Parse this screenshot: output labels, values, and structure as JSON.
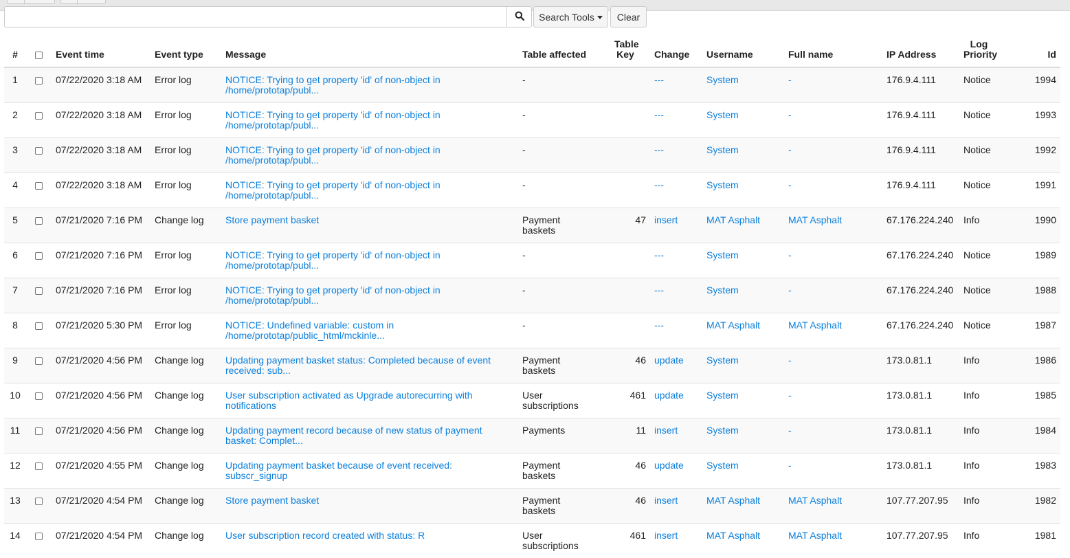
{
  "toolbar": {
    "search_value": "",
    "search_tools_label": "Search Tools",
    "clear_label": "Clear"
  },
  "columns": {
    "num": "#",
    "event_time": "Event time",
    "event_type": "Event type",
    "message": "Message",
    "table_affected": "Table affected",
    "table_key": "Table Key",
    "change": "Change",
    "username": "Username",
    "full_name": "Full name",
    "ip_address": "IP Address",
    "log_priority": "Log Priority",
    "id": "Id"
  },
  "rows": [
    {
      "num": "1",
      "time": "07/22/2020 3:18 AM",
      "type": "Error log",
      "message": "NOTICE: Trying to get property 'id' of non-object in /home/prototap/publ...",
      "table": "-",
      "key": "",
      "change": "---",
      "username": "System",
      "fullname": "-",
      "ip": "176.9.4.111",
      "priority": "Notice",
      "id": "1994"
    },
    {
      "num": "2",
      "time": "07/22/2020 3:18 AM",
      "type": "Error log",
      "message": "NOTICE: Trying to get property 'id' of non-object in /home/prototap/publ...",
      "table": "-",
      "key": "",
      "change": "---",
      "username": "System",
      "fullname": "-",
      "ip": "176.9.4.111",
      "priority": "Notice",
      "id": "1993"
    },
    {
      "num": "3",
      "time": "07/22/2020 3:18 AM",
      "type": "Error log",
      "message": "NOTICE: Trying to get property 'id' of non-object in /home/prototap/publ...",
      "table": "-",
      "key": "",
      "change": "---",
      "username": "System",
      "fullname": "-",
      "ip": "176.9.4.111",
      "priority": "Notice",
      "id": "1992"
    },
    {
      "num": "4",
      "time": "07/22/2020 3:18 AM",
      "type": "Error log",
      "message": "NOTICE: Trying to get property 'id' of non-object in /home/prototap/publ...",
      "table": "-",
      "key": "",
      "change": "---",
      "username": "System",
      "fullname": "-",
      "ip": "176.9.4.111",
      "priority": "Notice",
      "id": "1991"
    },
    {
      "num": "5",
      "time": "07/21/2020 7:16 PM",
      "type": "Change log",
      "message": "Store payment basket",
      "table": "Payment baskets",
      "key": "47",
      "change": "insert",
      "username": "MAT Asphalt",
      "fullname": "MAT Asphalt",
      "ip": "67.176.224.240",
      "priority": "Info",
      "id": "1990"
    },
    {
      "num": "6",
      "time": "07/21/2020 7:16 PM",
      "type": "Error log",
      "message": "NOTICE: Trying to get property 'id' of non-object in /home/prototap/publ...",
      "table": "-",
      "key": "",
      "change": "---",
      "username": "System",
      "fullname": "-",
      "ip": "67.176.224.240",
      "priority": "Notice",
      "id": "1989"
    },
    {
      "num": "7",
      "time": "07/21/2020 7:16 PM",
      "type": "Error log",
      "message": "NOTICE: Trying to get property 'id' of non-object in /home/prototap/publ...",
      "table": "-",
      "key": "",
      "change": "---",
      "username": "System",
      "fullname": "-",
      "ip": "67.176.224.240",
      "priority": "Notice",
      "id": "1988"
    },
    {
      "num": "8",
      "time": "07/21/2020 5:30 PM",
      "type": "Error log",
      "message": "NOTICE: Undefined variable: custom in /home/prototap/public_html/mckinle...",
      "table": "-",
      "key": "",
      "change": "---",
      "username": "MAT Asphalt",
      "fullname": "MAT Asphalt",
      "ip": "67.176.224.240",
      "priority": "Notice",
      "id": "1987"
    },
    {
      "num": "9",
      "time": "07/21/2020 4:56 PM",
      "type": "Change log",
      "message": "Updating payment basket status: Completed because of event received: sub...",
      "table": "Payment baskets",
      "key": "46",
      "change": "update",
      "username": "System",
      "fullname": "-",
      "ip": "173.0.81.1",
      "priority": "Info",
      "id": "1986"
    },
    {
      "num": "10",
      "time": "07/21/2020 4:56 PM",
      "type": "Change log",
      "message": "User subscription activated as Upgrade autorecurring with notifications",
      "table": "User subscriptions",
      "key": "461",
      "change": "update",
      "username": "System",
      "fullname": "-",
      "ip": "173.0.81.1",
      "priority": "Info",
      "id": "1985"
    },
    {
      "num": "11",
      "time": "07/21/2020 4:56 PM",
      "type": "Change log",
      "message": "Updating payment record because of new status of payment basket: Complet...",
      "table": "Payments",
      "key": "11",
      "change": "insert",
      "username": "System",
      "fullname": "-",
      "ip": "173.0.81.1",
      "priority": "Info",
      "id": "1984"
    },
    {
      "num": "12",
      "time": "07/21/2020 4:55 PM",
      "type": "Change log",
      "message": "Updating payment basket because of event received: subscr_signup",
      "table": "Payment baskets",
      "key": "46",
      "change": "update",
      "username": "System",
      "fullname": "-",
      "ip": "173.0.81.1",
      "priority": "Info",
      "id": "1983"
    },
    {
      "num": "13",
      "time": "07/21/2020 4:54 PM",
      "type": "Change log",
      "message": "Store payment basket",
      "table": "Payment baskets",
      "key": "46",
      "change": "insert",
      "username": "MAT Asphalt",
      "fullname": "MAT Asphalt",
      "ip": "107.77.207.95",
      "priority": "Info",
      "id": "1982"
    },
    {
      "num": "14",
      "time": "07/21/2020 4:54 PM",
      "type": "Change log",
      "message": "User subscription record created with status: R",
      "table": "User subscriptions",
      "key": "461",
      "change": "insert",
      "username": "MAT Asphalt",
      "fullname": "MAT Asphalt",
      "ip": "107.77.207.95",
      "priority": "Info",
      "id": "1981"
    }
  ]
}
